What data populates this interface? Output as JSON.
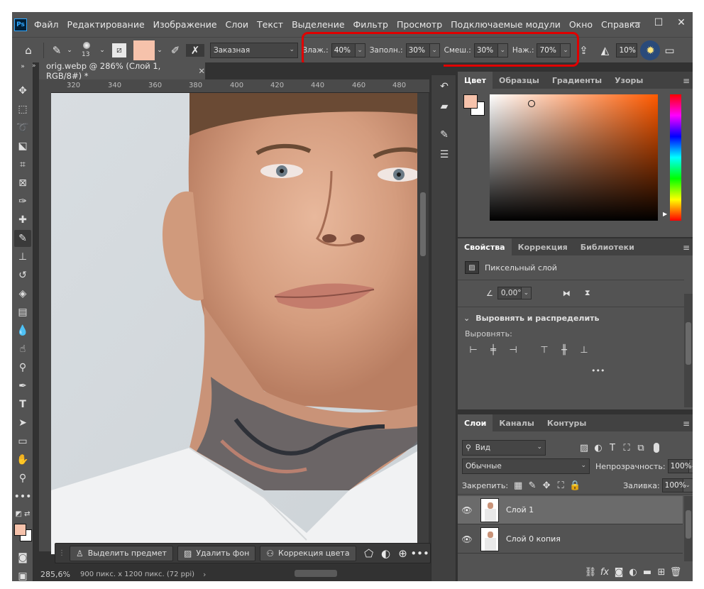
{
  "app": {
    "logo": "Ps"
  },
  "menu": [
    "Файл",
    "Редактирование",
    "Изображение",
    "Слои",
    "Текст",
    "Выделение",
    "Фильтр",
    "Просмотр",
    "Подключаемые модули",
    "Окно",
    "Справка"
  ],
  "window_controls": [
    "minimize-icon",
    "maximize-icon",
    "close-icon"
  ],
  "options": {
    "brush_size": "13",
    "brush_preset": "Заказная",
    "wet_label": "Влаж.:",
    "wet_value": "40%",
    "load_label": "Заполн.:",
    "load_value": "30%",
    "mix_label": "Смеш.:",
    "mix_value": "30%",
    "flow_label": "Наж.:",
    "flow_value": "70%",
    "smoothing_value": "10%",
    "angle_value": "0",
    "swatch_color": "#f6c2ab"
  },
  "document": {
    "tab_title": "orig.webp @ 286% (Слой 1, RGB/8#) *",
    "ruler_h": [
      "320",
      "340",
      "360",
      "380",
      "400",
      "420",
      "440",
      "460",
      "480"
    ],
    "zoom": "285,6%",
    "info": "900 пикс. x 1200 пикс. (72 ppi)"
  },
  "context_bar": {
    "select_subject": "Выделить предмет",
    "remove_bg": "Удалить фон",
    "color_correction": "Коррекция цвета"
  },
  "color_panel": {
    "tabs": [
      "Цвет",
      "Образцы",
      "Градиенты",
      "Узоры"
    ],
    "foreground": "#f6c2ab",
    "background": "#ffffff",
    "hue_base": "#ff5a00"
  },
  "properties_panel": {
    "tabs": [
      "Свойства",
      "Коррекция",
      "Библиотеки"
    ],
    "layer_type": "Пиксельный слой",
    "angle": "0,00°",
    "align_section": "Выровнять и распределить",
    "align_label": "Выровнять:"
  },
  "layers_panel": {
    "tabs": [
      "Слои",
      "Каналы",
      "Контуры"
    ],
    "filter_kind": "Вид",
    "blend_mode": "Обычные",
    "opacity_label": "Непрозрачность:",
    "opacity_value": "100%",
    "lock_label": "Закрепить:",
    "fill_label": "Заливка:",
    "fill_value": "100%",
    "layers": [
      {
        "name": "Слой 1",
        "selected": true
      },
      {
        "name": "Слой 0 копия",
        "selected": false
      }
    ]
  }
}
